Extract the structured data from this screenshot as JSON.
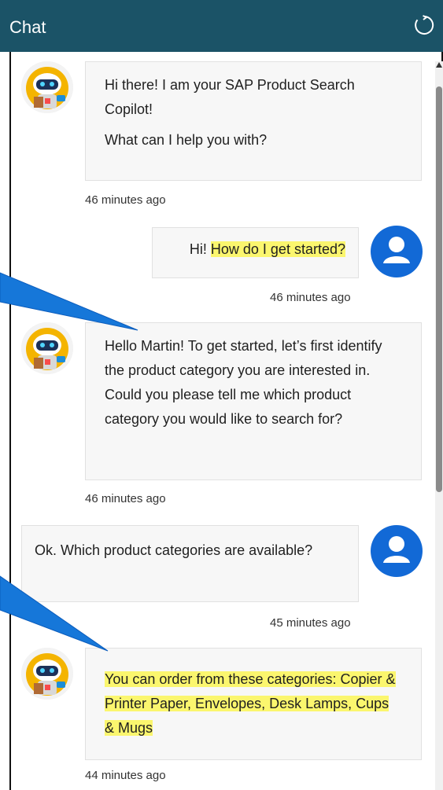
{
  "header": {
    "title": "Chat",
    "refresh_icon": "refresh-icon"
  },
  "messages": [
    {
      "sender": "bot",
      "lines": [
        "Hi there! I am your SAP Product Search Copilot!",
        "What can I help you with?"
      ],
      "time": "46 minutes ago"
    },
    {
      "sender": "user",
      "text_plain": "Hi! ",
      "text_highlight": "How do I get started?",
      "time": "46 minutes ago"
    },
    {
      "sender": "bot",
      "text": "Hello Martin! To get started, let’s first identify the product category you are interested in. Could you please tell me which product category you would like to search for?",
      "time": "46 minutes ago"
    },
    {
      "sender": "user",
      "text": "Ok. Which product categories are available?",
      "time": "45 minutes ago"
    },
    {
      "sender": "bot",
      "text_highlight": "You can order from these categories: Copier & Printer Paper, Envelopes, Desk Lamps, Cups & Mugs",
      "time": "44 minutes ago"
    }
  ],
  "colors": {
    "header_bg": "#1b5367",
    "user_avatar": "#1269d6",
    "highlight": "#fbf66e",
    "callout": "#1677d9"
  },
  "icons": {
    "bot_avatar": "robot-avatar-icon",
    "user_avatar": "user-avatar-icon"
  }
}
